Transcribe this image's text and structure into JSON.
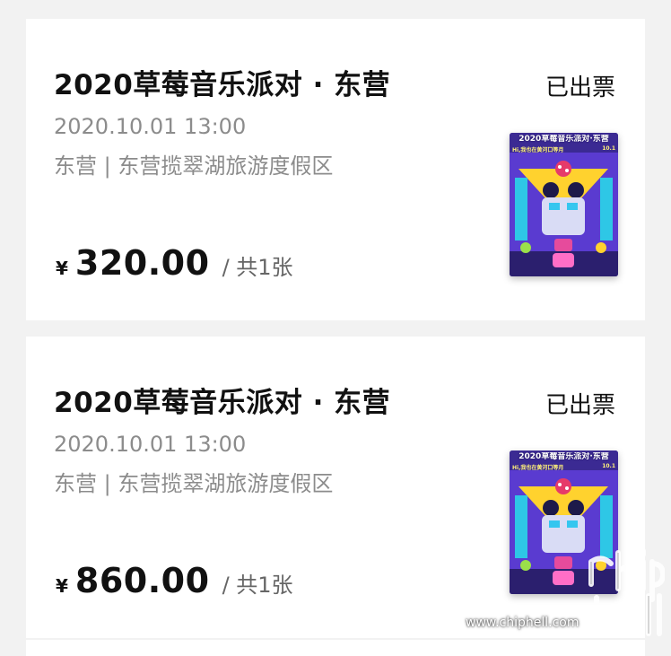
{
  "orders": [
    {
      "title": "2020草莓音乐派对 · 东营",
      "status": "已出票",
      "datetime": "2020.10.01 13:00",
      "venue": "东营 | 东营揽翠湖旅游度假区",
      "currency": "¥",
      "amount": "320.00",
      "quantity": "/ 共1张",
      "poster": {
        "title": "2020草莓音乐派对·东营",
        "subtitle_left": "Hi,我也在黄河口等月",
        "subtitle_right": "10.1"
      }
    },
    {
      "title": "2020草莓音乐派对 · 东营",
      "status": "已出票",
      "datetime": "2020.10.01 13:00",
      "venue": "东营 | 东营揽翠湖旅游度假区",
      "currency": "¥",
      "amount": "860.00",
      "quantity": "/ 共1张",
      "poster": {
        "title": "2020草莓音乐派对·东营",
        "subtitle_left": "Hi,我也在黄河口等月",
        "subtitle_right": "10.1"
      }
    }
  ],
  "watermark": {
    "site": "www.chiphell.com",
    "logo": "chip hell"
  },
  "colors": {
    "background": "#f2f2f2",
    "card": "#ffffff",
    "text_primary": "#111111",
    "text_secondary": "#8c8c8c",
    "poster_bg": "#3a2a8c"
  }
}
